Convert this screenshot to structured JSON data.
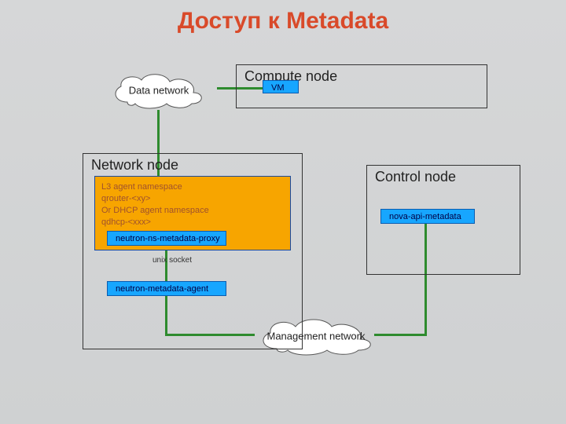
{
  "title": "Доступ к Metadata",
  "clouds": {
    "data": "Data network",
    "mgmt": "Management network"
  },
  "compute": {
    "title": "Compute node",
    "vm": "VM"
  },
  "network": {
    "title": "Network node",
    "agent_lines": "L3 agent namespace\nqrouter-<xy>\nOr DHCP agent namespace\nqdhcp-<xxx>",
    "proxy": "neutron-ns-metadata-proxy",
    "metadata_agent": "neutron-metadata-agent",
    "unix_socket": "unix socket"
  },
  "control": {
    "title": "Control node",
    "nova_api": "nova-api-metadata"
  },
  "colors": {
    "title": "#d94a2a",
    "chip_bg": "#17a6ff",
    "agent_bg": "#f7a500",
    "connector": "#2e8b2e"
  }
}
